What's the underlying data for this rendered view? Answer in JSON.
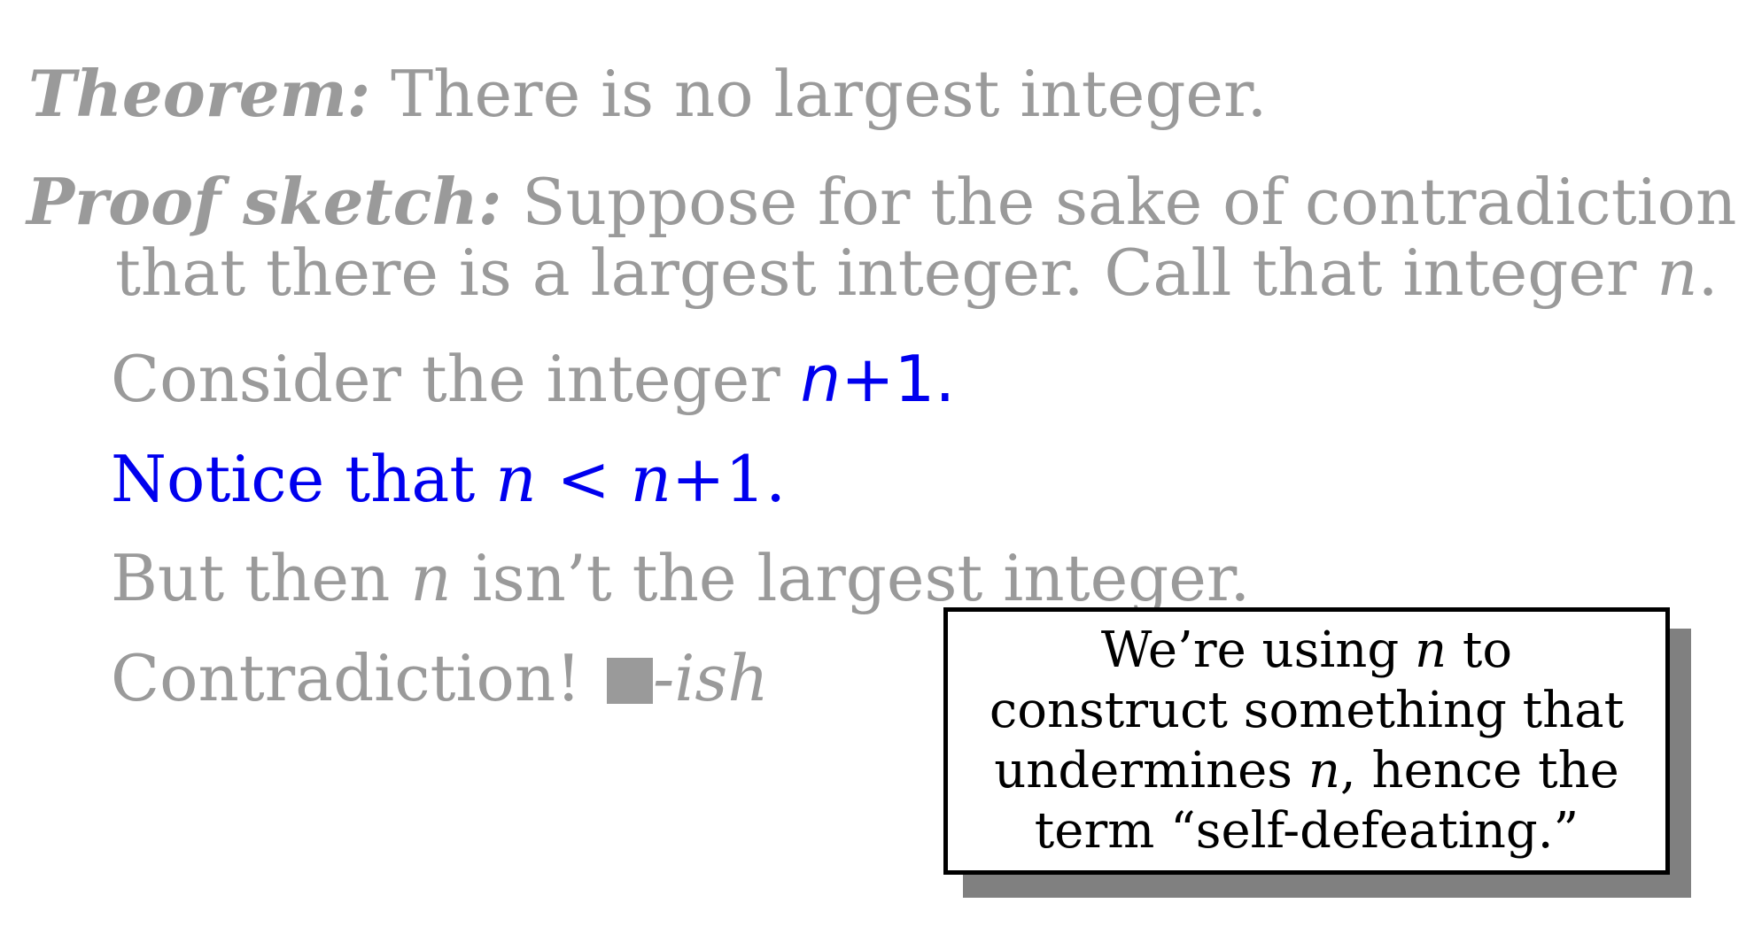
{
  "theorem": {
    "label": "Theorem:",
    "text": " There is no largest integer."
  },
  "proof": {
    "label": "Proof sketch:",
    "text1": " Suppose for the sake of contradiction",
    "text2": "that there is a largest integer. Call that integer ",
    "n": "n",
    "period": "."
  },
  "consider": {
    "text": "Consider the integer ",
    "n": "n",
    "expr": "+1."
  },
  "notice": {
    "text": "Notice that ",
    "n1": "n",
    "lt": " < ",
    "n2": "n",
    "expr": "+1."
  },
  "but": {
    "text1": "But then ",
    "n": "n",
    "text2": " isn’t the largest integer."
  },
  "contradiction": {
    "text": "Contradiction! ",
    "suffix": "-ish"
  },
  "callout": {
    "line1a": "We’re using ",
    "line1n": "n",
    "line1b": " to",
    "line2": "construct something that",
    "line3a": "undermines ",
    "line3n": "n",
    "line3b": ", hence the",
    "line4": "term “self-defeating.”"
  }
}
